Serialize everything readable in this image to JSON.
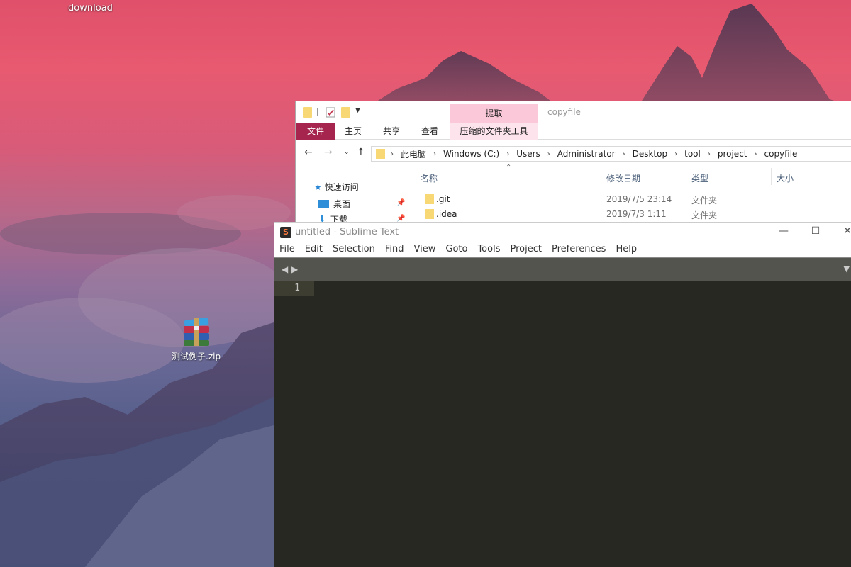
{
  "desktop": {
    "icons": [
      {
        "label": "download"
      },
      {
        "label": "测试例子.zip"
      }
    ]
  },
  "explorer": {
    "title": "copyfile",
    "context_tab": "提取",
    "ribbon_tabs": [
      "文件",
      "主页",
      "共享",
      "查看",
      "压缩的文件夹工具"
    ],
    "breadcrumbs": [
      "此电脑",
      "Windows (C:)",
      "Users",
      "Administrator",
      "Desktop",
      "tool",
      "project",
      "copyfile"
    ],
    "nav": [
      {
        "label": "快速访问",
        "icon": "star-icon"
      },
      {
        "label": "桌面",
        "icon": "desktop-icon"
      },
      {
        "label": "下载",
        "icon": "download-icon"
      }
    ],
    "columns": [
      "名称",
      "修改日期",
      "类型",
      "大小"
    ],
    "rows": [
      {
        "name": ".git",
        "date": "2019/7/5 23:14",
        "type": "文件夹"
      },
      {
        "name": ".idea",
        "date": "2019/7/3 1:11",
        "type": "文件夹"
      }
    ]
  },
  "sublime": {
    "title": "untitled - Sublime Text",
    "logo": "S",
    "window_controls": [
      "—",
      "☐",
      "✕"
    ],
    "menu": [
      "File",
      "Edit",
      "Selection",
      "Find",
      "View",
      "Goto",
      "Tools",
      "Project",
      "Preferences",
      "Help"
    ],
    "line_numbers": [
      "1"
    ]
  },
  "colors": {
    "ribbon_file_tab": "#a5254e",
    "context_tab": "#fbc8d9",
    "editor_bg": "#272822",
    "tabbar_bg": "#52544d"
  }
}
